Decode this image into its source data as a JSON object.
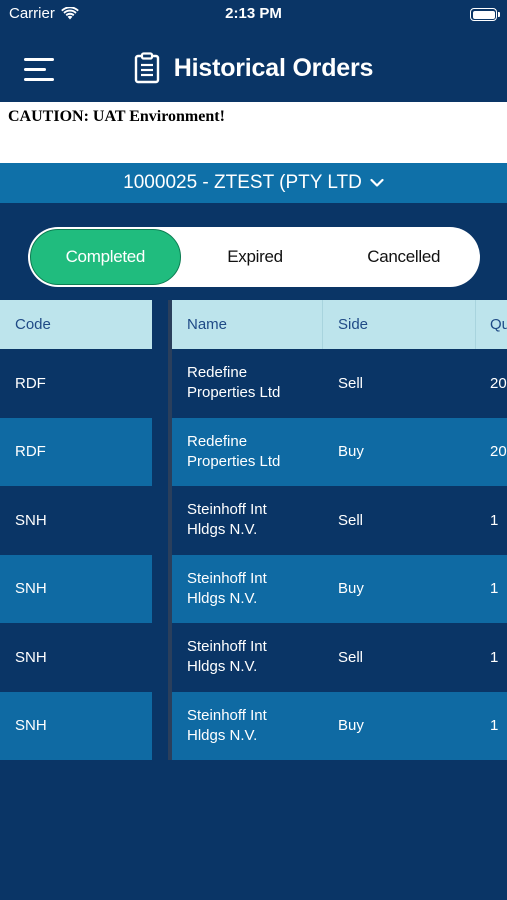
{
  "status_bar": {
    "carrier": "Carrier",
    "time": "2:13 PM"
  },
  "header": {
    "title": "Historical Orders",
    "menu_icon": "hamburger-menu-icon",
    "title_icon": "clipboard-icon"
  },
  "caution": "CAUTION: UAT Environment!",
  "account": {
    "label": "1000025 - ZTEST (PTY LTD",
    "icon": "chevron-down-icon"
  },
  "tabs": [
    {
      "label": "Completed",
      "active": true
    },
    {
      "label": "Expired",
      "active": false
    },
    {
      "label": "Cancelled",
      "active": false
    }
  ],
  "table": {
    "columns": {
      "code": "Code",
      "name": "Name",
      "side": "Side",
      "qty": "Qu"
    },
    "rows": [
      {
        "code": "RDF",
        "name1": "Redefine",
        "name2": "Properties Ltd",
        "side": "Sell",
        "qty": "20"
      },
      {
        "code": "RDF",
        "name1": "Redefine",
        "name2": "Properties Ltd",
        "side": "Buy",
        "qty": "20"
      },
      {
        "code": "SNH",
        "name1": "Steinhoff Int",
        "name2": "Hldgs N.V.",
        "side": "Sell",
        "qty": "1"
      },
      {
        "code": "SNH",
        "name1": "Steinhoff Int",
        "name2": "Hldgs N.V.",
        "side": "Buy",
        "qty": "1"
      },
      {
        "code": "SNH",
        "name1": "Steinhoff Int",
        "name2": "Hldgs N.V.",
        "side": "Sell",
        "qty": "1"
      },
      {
        "code": "SNH",
        "name1": "Steinhoff Int",
        "name2": "Hldgs N.V.",
        "side": "Buy",
        "qty": "1"
      }
    ]
  },
  "colors": {
    "background": "#0a3566",
    "row_alt": "#0f6aa3",
    "header_bg": "#bde4ec",
    "active_tab": "#20bc7e"
  }
}
